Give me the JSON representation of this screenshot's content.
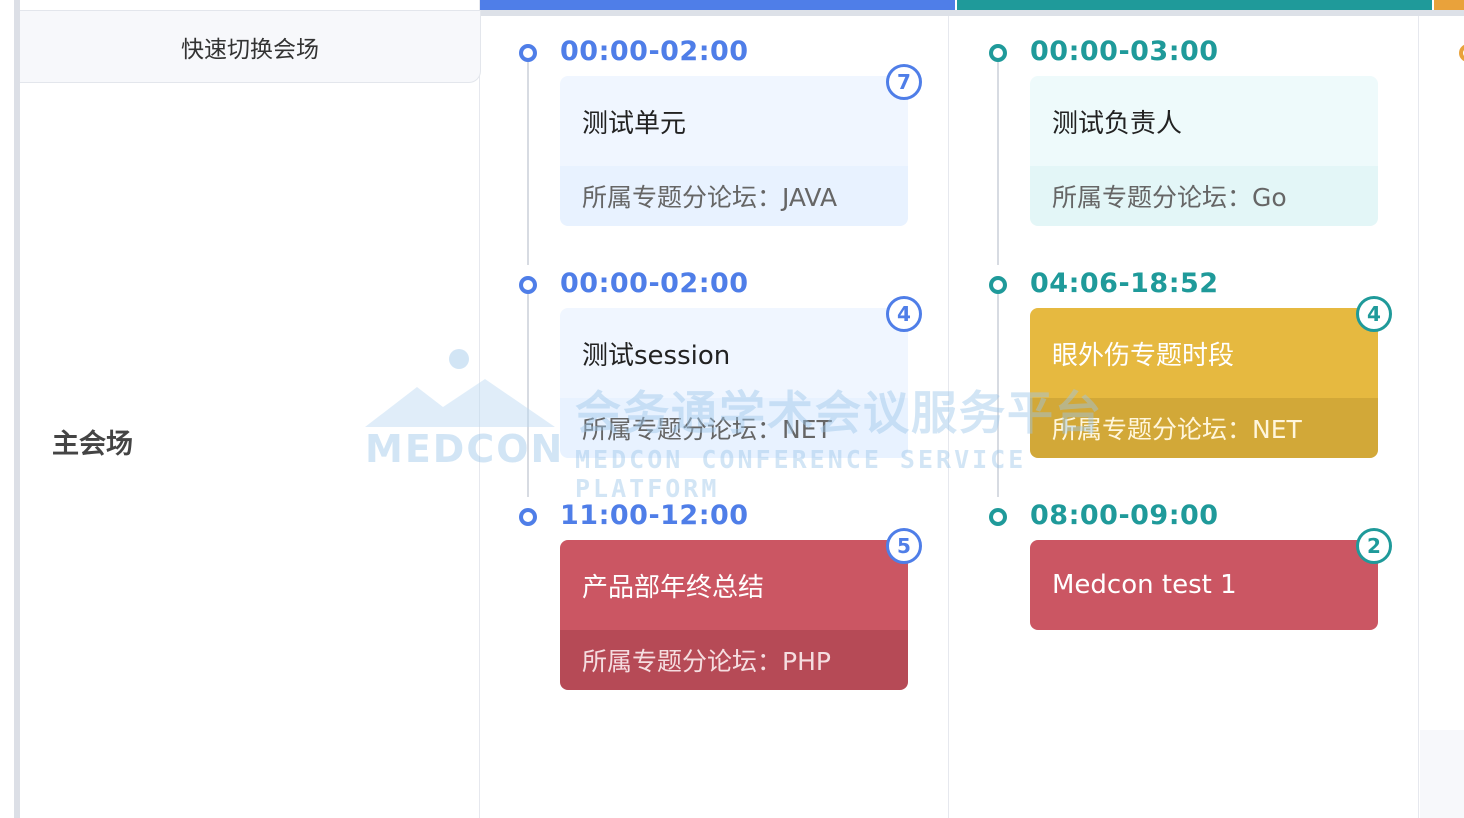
{
  "sidebar": {
    "switch_label": "快速切换会场",
    "hall_label": "主会场"
  },
  "colors": {
    "blue": "#4f7ee8",
    "teal": "#1f9a9a",
    "orange": "#e9a23b",
    "red": "#cb5663",
    "yellow": "#e6b940"
  },
  "columns": [
    {
      "accent": "#4f7ee8",
      "sessions": [
        {
          "time": "00:00-02:00",
          "title": "测试单元",
          "forum": "所属专题分论坛：JAVA",
          "count": "7",
          "style": "light-blue"
        },
        {
          "time": "00:00-02:00",
          "title": "测试session",
          "forum": "所属专题分论坛：NET",
          "count": "4",
          "style": "light-blue"
        },
        {
          "time": "11:00-12:00",
          "title": "产品部年终总结",
          "forum": "所属专题分论坛：PHP",
          "count": "5",
          "style": "red"
        }
      ]
    },
    {
      "accent": "#1f9a9a",
      "sessions": [
        {
          "time": "00:00-03:00",
          "title": "测试负责人",
          "forum": "所属专题分论坛：Go",
          "count": "",
          "style": "light-teal"
        },
        {
          "time": "04:06-18:52",
          "title": "眼外伤专题时段",
          "forum": "所属专题分论坛：NET",
          "count": "4",
          "style": "yellow"
        },
        {
          "time": "08:00-09:00",
          "title": "Medcon test 1",
          "forum": "",
          "count": "2",
          "style": "red"
        }
      ]
    }
  ],
  "watermark": {
    "logo_text": "MEDCON",
    "cn": "会务通学术会议服务平台",
    "en": "MEDCON CONFERENCE SERVICE PLATFORM"
  }
}
